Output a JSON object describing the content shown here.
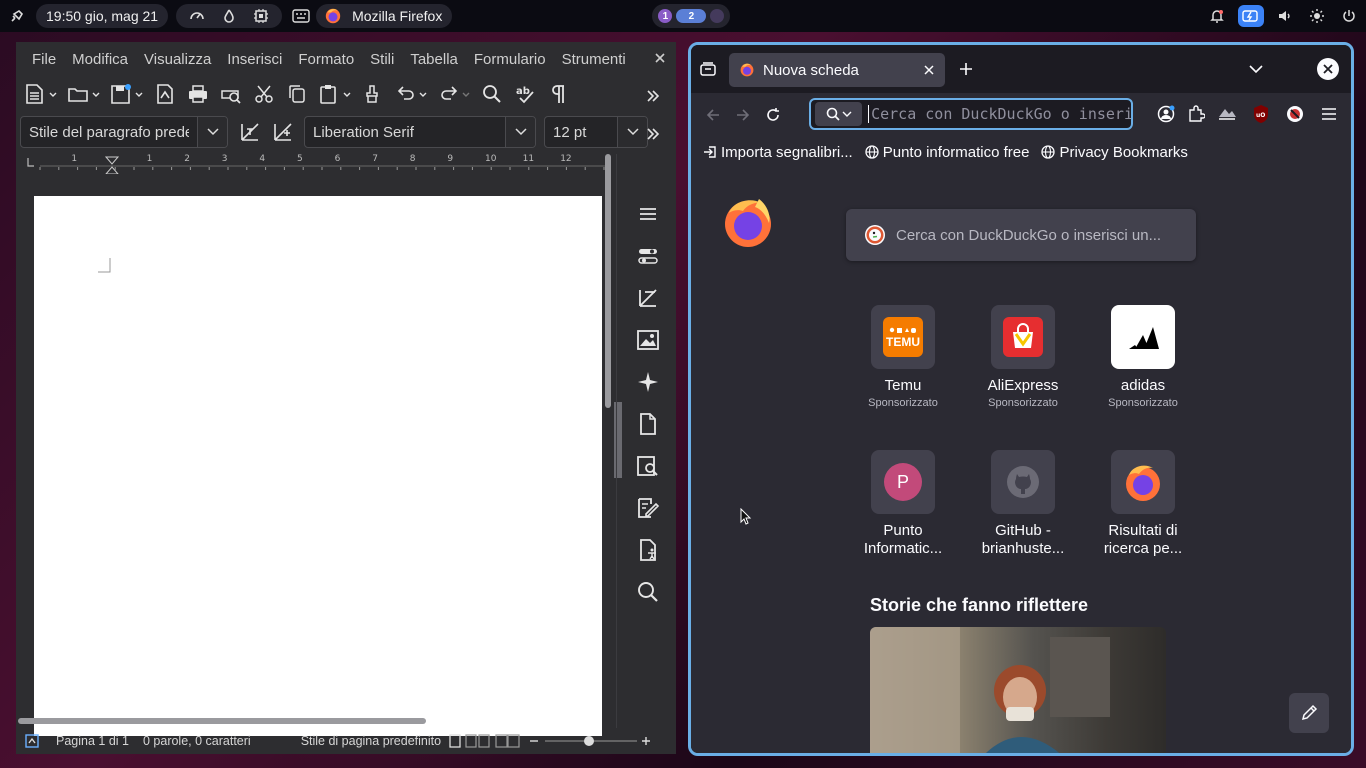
{
  "topbar": {
    "clock": "19:50 gio, mag 21",
    "workspaces": [
      "1",
      "2"
    ],
    "active_app": "Mozilla Firefox"
  },
  "writer": {
    "menus": [
      "File",
      "Modifica",
      "Visualizza",
      "Inserisci",
      "Formato",
      "Stili",
      "Tabella",
      "Formulario",
      "Strumenti"
    ],
    "paragraph_style": "Stile del paragrafo predefinito",
    "font_name": "Liberation Serif",
    "font_size": "12 pt",
    "ruler_marks": [
      "1",
      "1",
      "2",
      "3",
      "4",
      "5",
      "6",
      "7",
      "8",
      "9",
      "10",
      "11",
      "12"
    ],
    "status": {
      "page": "Pagina 1 di 1",
      "words": "0 parole, 0 caratteri",
      "page_style": "Stile di pagina predefinito"
    }
  },
  "firefox": {
    "tab_title": "Nuova scheda",
    "url_placeholder": "Cerca con DuckDuckGo o inserisci u",
    "bookmarks": [
      "Importa segnalibri...",
      "Punto informatico free",
      "Privacy Bookmarks"
    ],
    "search_placeholder": "Cerca con DuckDuckGo o inserisci un...",
    "shortcuts": [
      {
        "name": "Temu",
        "sponsor": "Sponsorizzato",
        "logo": "temu-logo",
        "logo_text": "TEMU"
      },
      {
        "name": "AliExpress",
        "sponsor": "Sponsorizzato",
        "logo": "aliexpress-logo"
      },
      {
        "name": "adidas",
        "sponsor": "Sponsorizzato",
        "logo": "adidas-logo"
      },
      {
        "name": "Punto\nInformatic...",
        "logo": "letter-avatar",
        "letter": "P"
      },
      {
        "name": "GitHub -\nbrianhuste...",
        "logo": "github-logo"
      },
      {
        "name": "Risultati di\nricerca pe...",
        "logo": "firefox-logo"
      }
    ],
    "stories_title": "Storie che fanno riflettere"
  },
  "colors": {
    "accent": "#6aaee6",
    "firefox_bg": "#2b2a33",
    "writer_bg": "#2d2d30",
    "temu": "#f57c00",
    "aliexpress": "#e62e30",
    "avatar": "#c24a7a"
  }
}
